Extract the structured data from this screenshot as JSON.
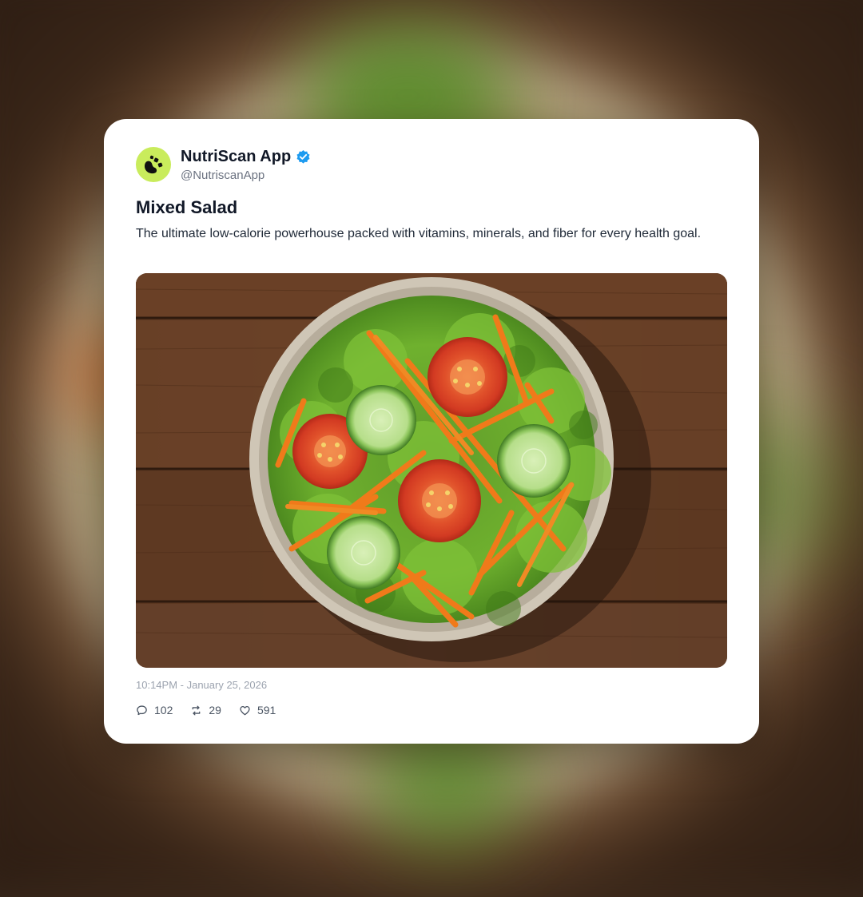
{
  "post": {
    "display_name": "NutriScan App",
    "handle": "@NutriscanApp",
    "verified": true,
    "title": "Mixed Salad",
    "description": "The ultimate low-calorie powerhouse packed with vitamins, minerals, and fiber for every health goal.",
    "timestamp": "10:14PM - January 25, 2026",
    "stats": {
      "replies": "102",
      "reposts": "29",
      "likes": "591"
    },
    "icons": {
      "avatar": "nutriscan-logo-icon",
      "verified": "verified-badge-icon",
      "replies": "comment-icon",
      "reposts": "repost-icon",
      "likes": "heart-icon"
    },
    "colors": {
      "avatar_bg": "#c9ec5c",
      "verified": "#1d9bf0",
      "card": "#ffffff"
    }
  }
}
